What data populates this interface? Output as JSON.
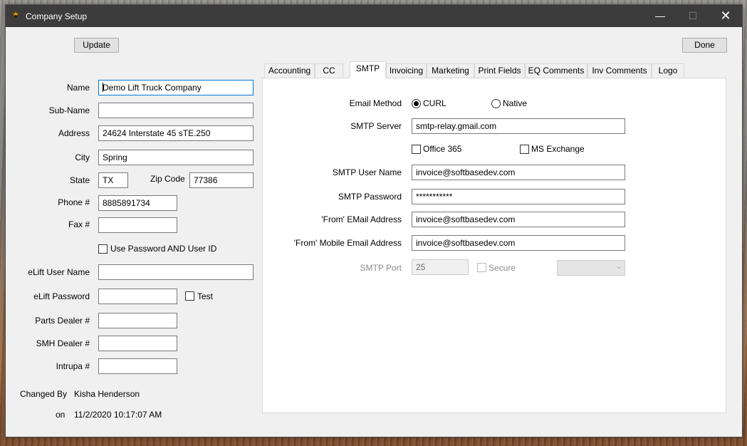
{
  "window": {
    "title": "Company Setup"
  },
  "toolbar": {
    "update_label": "Update",
    "done_label": "Done"
  },
  "left": {
    "name_label": "Name",
    "name_value": "Demo Lift Truck Company",
    "subname_label": "Sub-Name",
    "subname_value": "",
    "address_label": "Address",
    "address_value": "24624 Interstate 45 sTE.250",
    "city_label": "City",
    "city_value": "Spring",
    "state_label": "State",
    "state_value": "TX",
    "zip_label": "Zip Code",
    "zip_value": "77386",
    "phone_label": "Phone #",
    "phone_value": "8885891734",
    "fax_label": "Fax #",
    "fax_value": "",
    "use_password_label": "Use Password AND User ID",
    "elift_user_label": "eLift User Name",
    "elift_user_value": "",
    "elift_password_label": "eLift Password",
    "elift_password_value": "",
    "test_label": "Test",
    "parts_dealer_label": "Parts Dealer #",
    "parts_dealer_value": "",
    "smh_dealer_label": "SMH Dealer #",
    "smh_dealer_value": "",
    "intrupa_label": "Intrupa #",
    "intrupa_value": "",
    "changed_by_label": "Changed By",
    "changed_by_value": "Kisha Henderson",
    "on_label": "on",
    "on_value": "11/2/2020 10:17:07 AM"
  },
  "tabs": [
    "Accounting",
    "CC",
    "SMTP",
    "Invoicing",
    "Marketing",
    "Print Fields",
    "EQ Comments",
    "Inv Comments",
    "Logo"
  ],
  "active_tab": "SMTP",
  "smtp": {
    "email_method_label": "Email Method",
    "curl_label": "CURL",
    "native_label": "Native",
    "selected_method": "CURL",
    "server_label": "SMTP Server",
    "server_value": "smtp-relay.gmail.com",
    "office365_label": "Office 365",
    "ms_exchange_label": "MS Exchange",
    "user_label": "SMTP User Name",
    "user_value": "invoice@softbasedev.com",
    "password_label": "SMTP Password",
    "password_value": "***********",
    "from_email_label": "'From' EMail Address",
    "from_email_value": "invoice@softbasedev.com",
    "from_mobile_label": "'From' Mobile Email Address",
    "from_mobile_value": "invoice@softbasedev.com",
    "port_label": "SMTP Port",
    "port_value": "25",
    "secure_label": "Secure"
  }
}
